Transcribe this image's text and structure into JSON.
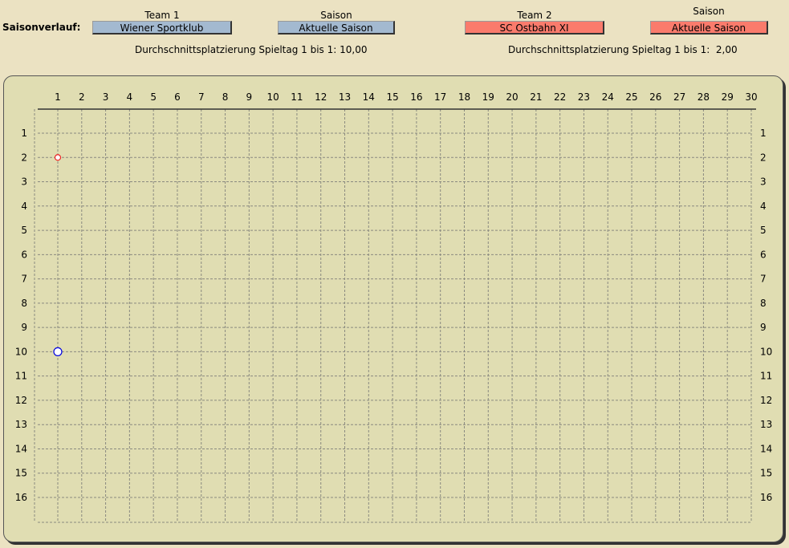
{
  "header": {
    "title": "Saisonverlauf:",
    "team1": {
      "label": "Team 1",
      "value": "Wiener Sportklub",
      "color": "#a3b9d0"
    },
    "season1": {
      "label": "Saison",
      "value": "Aktuelle Saison",
      "color": "#a3b9d0"
    },
    "team2": {
      "label": "Team 2",
      "value": "SC Ostbahn XI",
      "color": "#fa7b6c"
    },
    "season2": {
      "label": "Saison",
      "value": "Aktuelle Saison",
      "color": "#fa7b6c"
    },
    "avg1": "Durchschnittsplatzierung Spieltag 1 bis 1: 10,00",
    "avg2": "Durchschnittsplatzierung Spieltag 1 bis 1:  2,00"
  },
  "chart_data": {
    "type": "scatter",
    "x_ticks": [
      1,
      2,
      3,
      4,
      5,
      6,
      7,
      8,
      9,
      10,
      11,
      12,
      13,
      14,
      15,
      16,
      17,
      18,
      19,
      20,
      21,
      22,
      23,
      24,
      25,
      26,
      27,
      28,
      29,
      30
    ],
    "y_ticks": [
      1,
      2,
      3,
      4,
      5,
      6,
      7,
      8,
      9,
      10,
      11,
      12,
      13,
      14,
      15,
      16
    ],
    "xlim": [
      1,
      30
    ],
    "ylim": [
      1,
      16
    ],
    "y_inverted": true,
    "grid": true,
    "series": [
      {
        "name": "Wiener Sportklub",
        "color": "#0000dd",
        "points": [
          {
            "x": 1,
            "y": 10
          }
        ]
      },
      {
        "name": "SC Ostbahn XI",
        "color": "#ee2222",
        "points": [
          {
            "x": 1,
            "y": 2
          }
        ]
      }
    ]
  }
}
